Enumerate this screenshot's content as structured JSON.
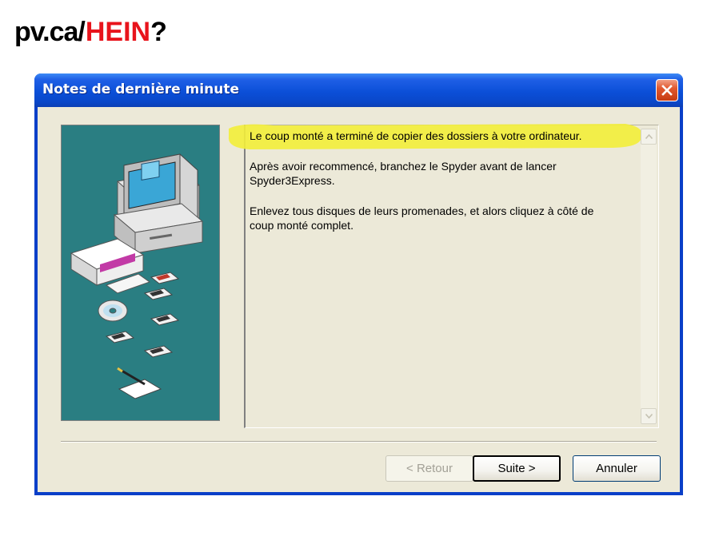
{
  "branding": {
    "site": "pv.ca",
    "slash": "/",
    "word": "HEIN",
    "punct": "?",
    "accent_color": "#e8141c"
  },
  "window": {
    "title": "Notes de dernière minute",
    "close_icon": "close-x-icon",
    "titlebar_color": "#0a47c9"
  },
  "notes": {
    "highlighted": "Le coup monté a terminé de copier des dossiers à votre ordinateur.",
    "paragraph2_line1": "Après avoir recommencé, branchez le Spyder avant de lancer",
    "paragraph2_line2": "Spyder3Express.",
    "paragraph3_line1": "Enlevez tous disques de leurs promenades, et alors cliquez à côté de",
    "paragraph3_line2": "coup monté complet.",
    "highlight_color": "#f3ee3a"
  },
  "buttons": {
    "back": "< Retour",
    "next": "Suite >",
    "cancel": "Annuler"
  },
  "illustration": {
    "background": "#2a7e82",
    "icons": [
      "computer-icon",
      "software-box-icon",
      "cd-disc-icon",
      "floppy-disk-icon",
      "document-pen-icon"
    ]
  }
}
